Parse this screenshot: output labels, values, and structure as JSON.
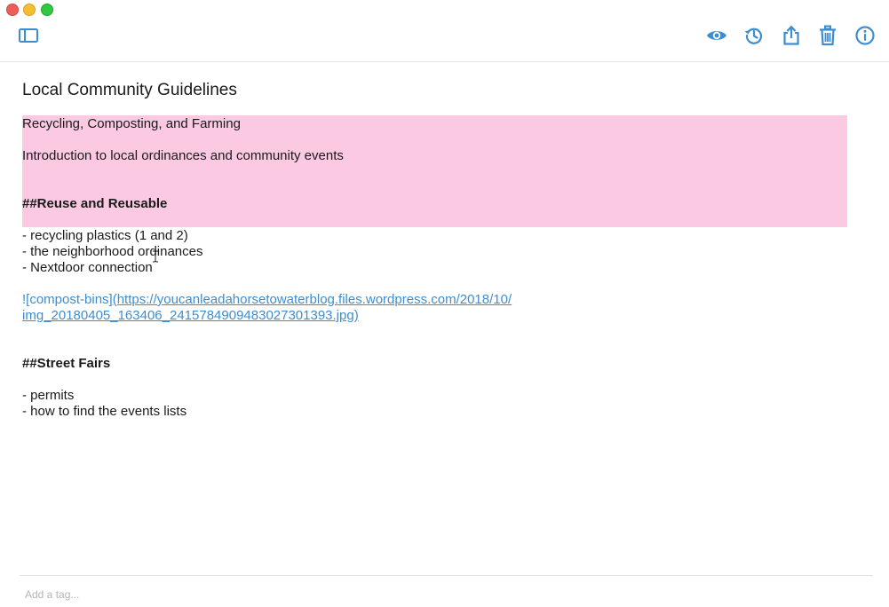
{
  "window": {
    "controls": [
      "close",
      "minimize",
      "maximize"
    ]
  },
  "toolbar": {
    "sidebar_icon": "sidebar-toggle-icon",
    "right_icons": [
      "eye-icon",
      "history-icon",
      "share-icon",
      "trash-icon",
      "info-icon"
    ],
    "accent_color": "#3d8ed0"
  },
  "note": {
    "title": "Local Community Guidelines",
    "highlight_color": "#fbc9e2",
    "highlighted": {
      "line1": "Recycling, Composting, and Farming",
      "line2": "Introduction to local ordinances and community events",
      "heading": "##Reuse and Reusable"
    },
    "list1": [
      "- recycling plastics (1 and 2)",
      "- the neighborhood ordinances",
      "- Nextdoor connection"
    ],
    "image_link": {
      "alt_text": "![compost-bins]",
      "url_line1": "(https://youcanleadahorsetowaterblog.files.wordpress.com/2018/10/",
      "url_line2": "img_20180405_163406_2415784909483027301393.jpg)"
    },
    "heading2": "##Street Fairs",
    "list2": [
      "- permits",
      "- how to find the events lists"
    ]
  },
  "tags": {
    "placeholder": "Add a tag..."
  }
}
